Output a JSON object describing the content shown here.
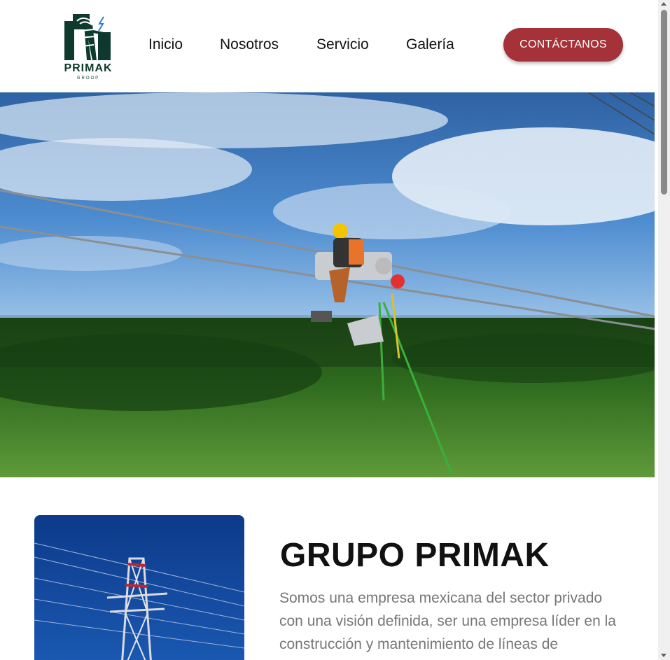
{
  "brand": {
    "name": "PRIMAK",
    "sub": "GROOP",
    "color": "#0e3a2e"
  },
  "nav": {
    "inicio": "Inicio",
    "nosotros": "Nosotros",
    "servicio": "Servicio",
    "galeria": "Galería"
  },
  "cta": {
    "label": "CONTÁCTANOS",
    "color": "#a43238"
  },
  "hero": {
    "image": "lineman-on-power-cable-photo"
  },
  "about": {
    "image": "transmission-tower-photo",
    "title": "GRUPO PRIMAK",
    "text": "Somos una empresa mexicana del sector privado con una visión definida, ser una empresa líder en la construcción y mantenimiento de líneas de"
  }
}
